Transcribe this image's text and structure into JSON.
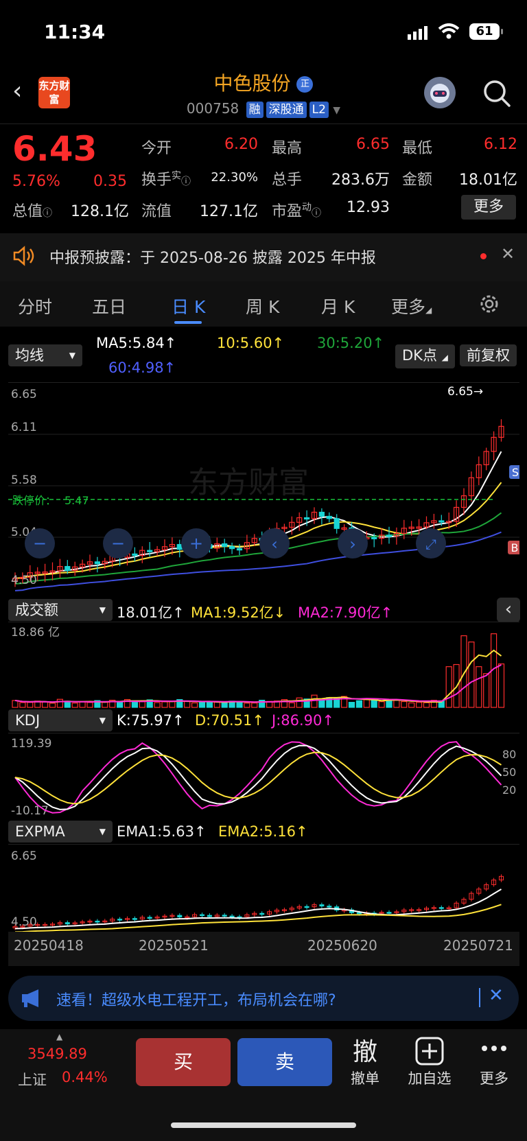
{
  "status": {
    "time": "11:34",
    "battery": "61"
  },
  "header": {
    "logo": "东方财富",
    "name": "中色股份",
    "badge": "正",
    "code": "000758",
    "tags": [
      "融",
      "深股通",
      "L2"
    ]
  },
  "quote": {
    "price": "6.43",
    "pct": "5.76%",
    "change": "0.35",
    "open_label": "今开",
    "open": "6.20",
    "high_label": "最高",
    "high": "6.65",
    "low_label": "最低",
    "low": "6.12",
    "turnover_label": "换手",
    "turnover_sup": "实",
    "turnover": "22.30%",
    "volume_label": "总手",
    "volume": "283.6万",
    "amount_label": "金额",
    "amount": "18.01亿",
    "mcap_label": "总值",
    "mcap": "128.1亿",
    "float_label": "流值",
    "float": "127.1亿",
    "pe_label": "市盈",
    "pe_sup": "动",
    "pe": "12.93",
    "more": "更多"
  },
  "notice": {
    "text": "中报预披露：于 2025-08-26 披露 2025 年中报"
  },
  "tabs": [
    "分时",
    "五日",
    "日 K",
    "周 K",
    "月 K",
    "更多"
  ],
  "ma_bar": {
    "dropdown": "均线",
    "ma5": "MA5:5.84↑",
    "ma10": "10:5.60↑",
    "ma30": "30:5.20↑",
    "ma60": "60:4.98↑",
    "dk": "DK点",
    "fq": "前复权"
  },
  "kline": {
    "y_labels": [
      "6.65",
      "6.11",
      "5.58",
      "5.04",
      "4.50"
    ],
    "limit_label": "跌停价：",
    "limit_price": "5.47",
    "max_marker": "6.65→",
    "b_marker": "B",
    "s_marker": "S"
  },
  "volume_bar": {
    "dropdown": "成交额",
    "value": "18.01亿↑",
    "ma1": "MA1:9.52亿↓",
    "ma2": "MA2:7.90亿↑",
    "max": "18.86 亿"
  },
  "kdj_bar": {
    "dropdown": "KDJ",
    "k": "K:75.97↑",
    "d": "D:70.51↑",
    "j": "J:86.90↑",
    "max": "119.39",
    "min": "-10.17",
    "l80": "80",
    "l50": "50",
    "l20": "20"
  },
  "expma_bar": {
    "dropdown": "EXPMA",
    "ema1": "EMA1:5.63↑",
    "ema2": "EMA2:5.16↑",
    "max": "6.65",
    "min": "4.50"
  },
  "dates": [
    "20250418",
    "20250521",
    "20250620",
    "20250721"
  ],
  "banner": {
    "text": "速看！超级水电工程开工，布局机会在哪?"
  },
  "bottom": {
    "index_value": "3549.89",
    "index_name": "上证",
    "index_pct": "0.44%",
    "buy": "买",
    "sell": "卖",
    "cancel_icon": "撤",
    "cancel": "撤单",
    "add": "加自选",
    "more": "更多"
  },
  "colors": {
    "up": "#ff2d2d",
    "down": "#19d4d4",
    "ma5": "#ffffff",
    "ma10": "#ffe23a",
    "ma30": "#1fa63a",
    "ma60": "#3f4fe0",
    "accent": "#4a8cff",
    "vol_ma2": "#ff2ad6"
  }
}
